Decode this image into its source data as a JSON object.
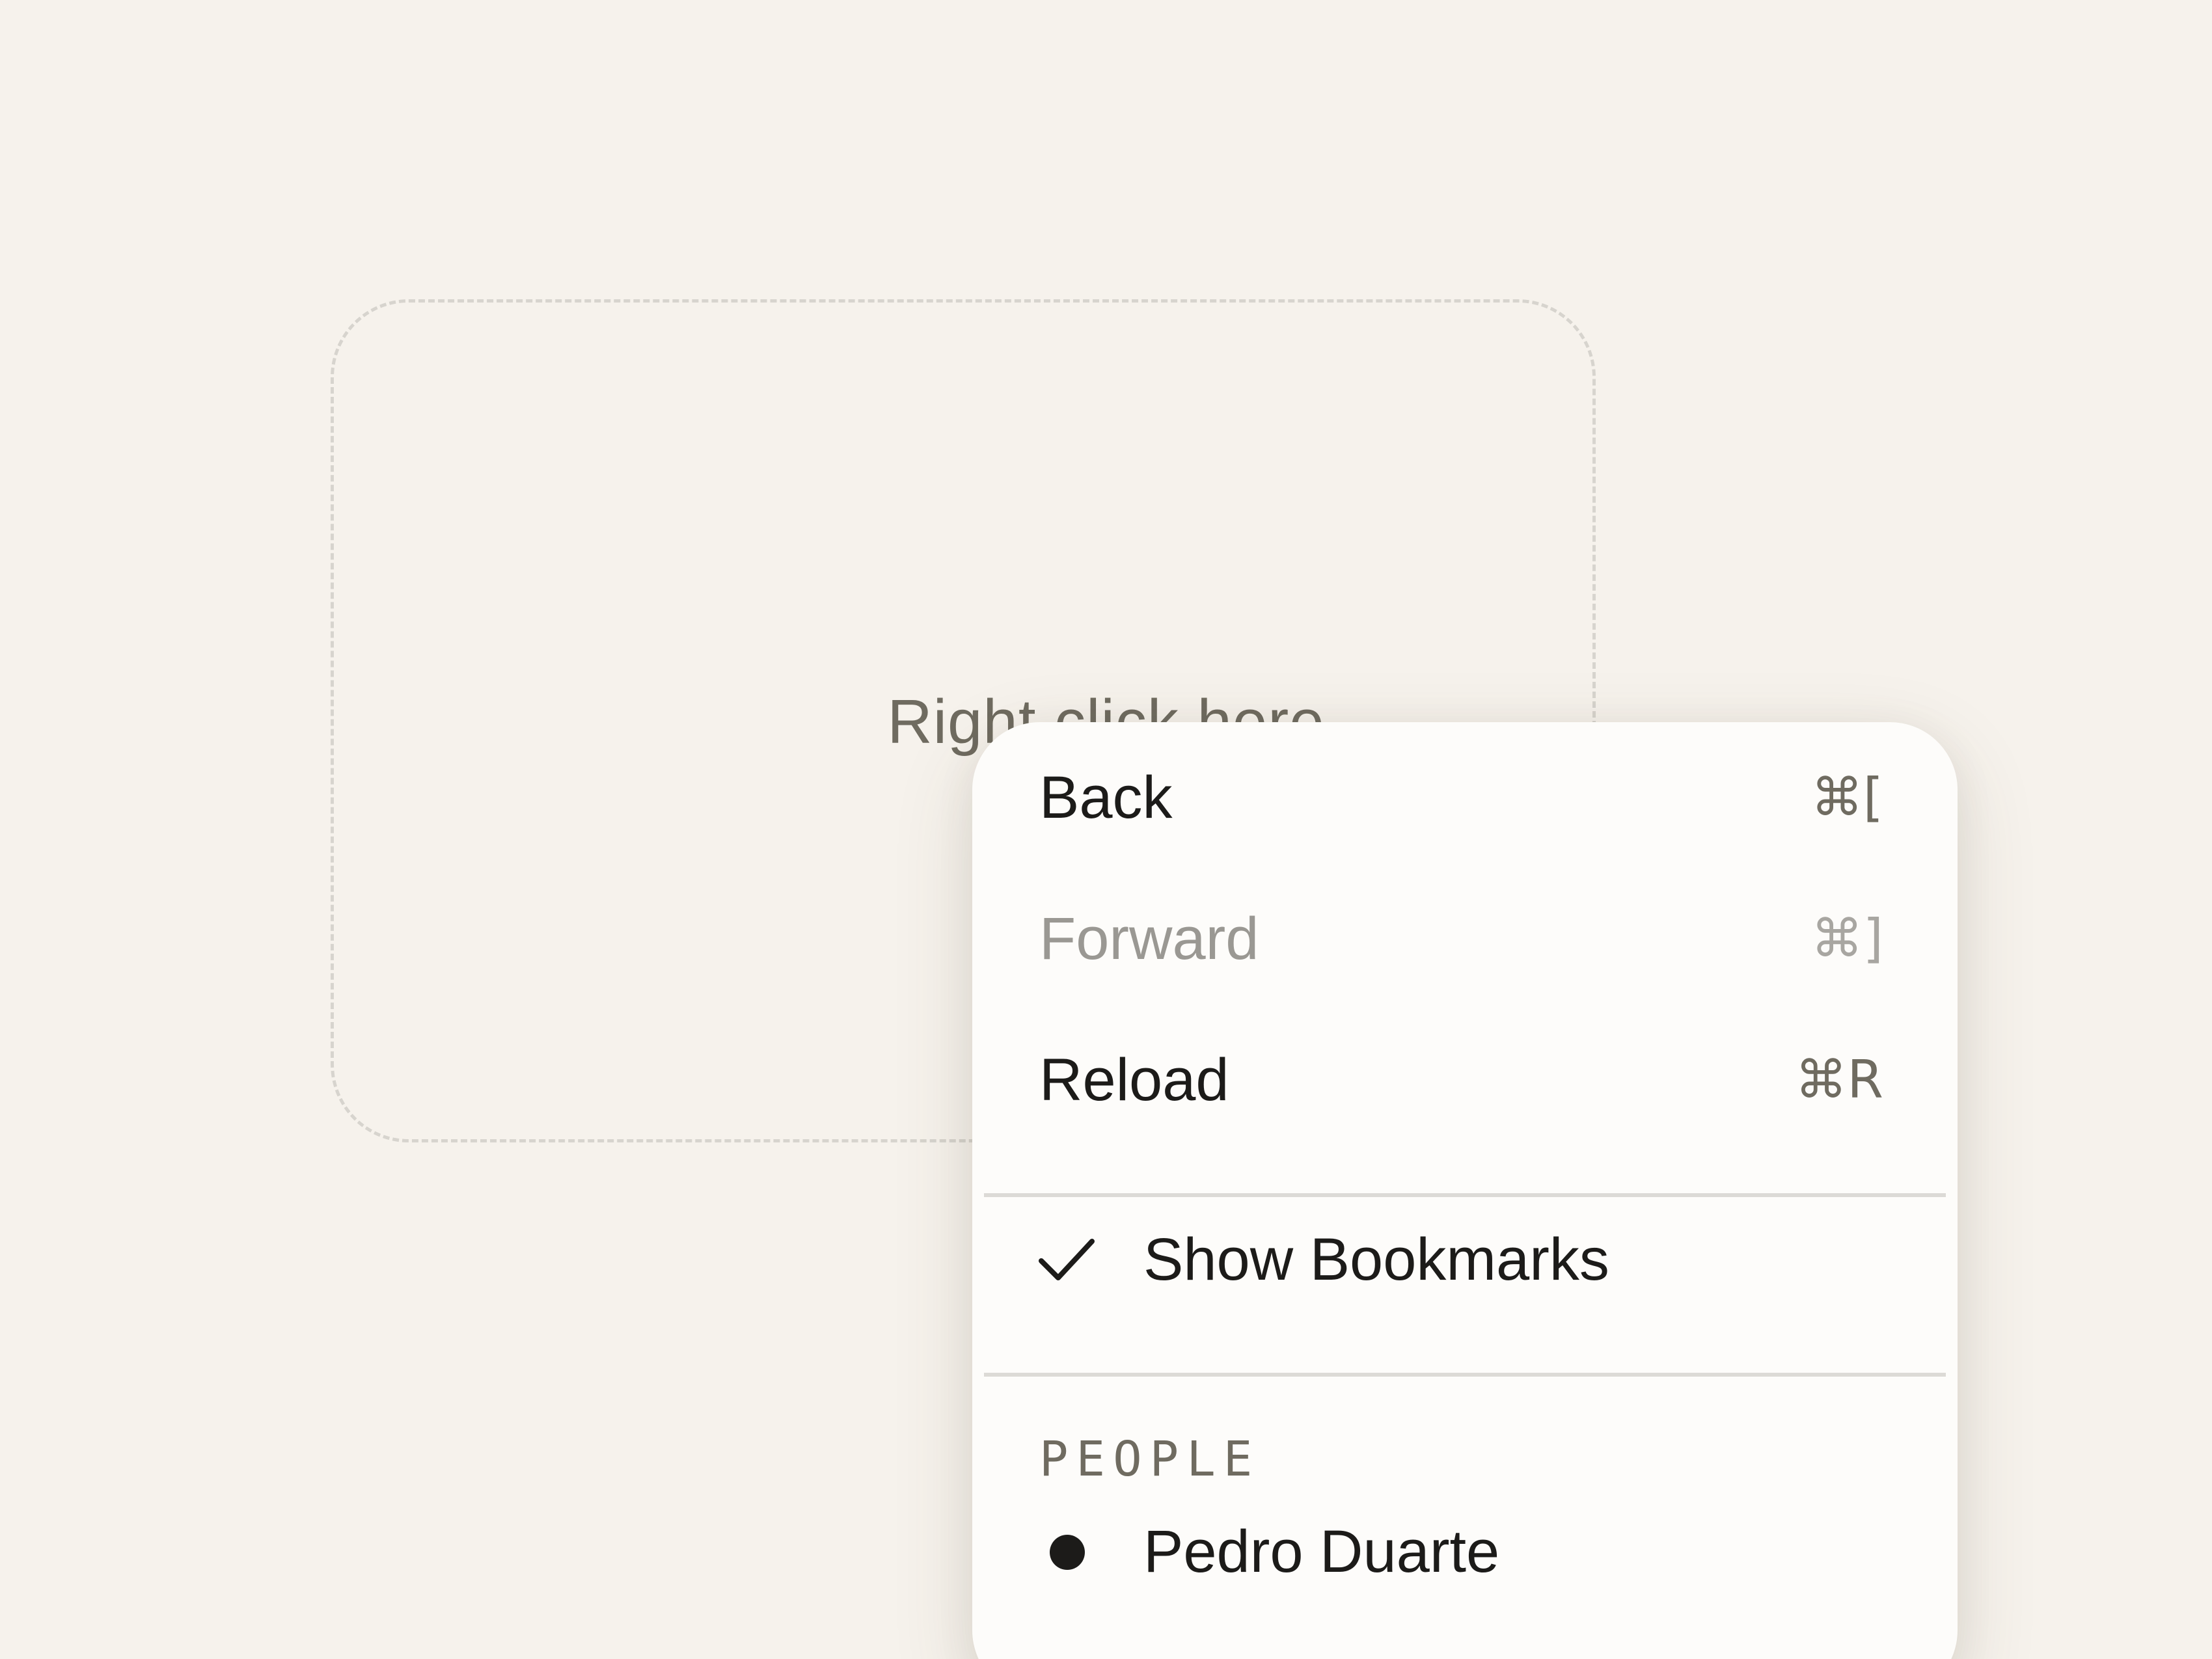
{
  "drop_zone": {
    "label": "Right click here"
  },
  "context_menu": {
    "items": [
      {
        "label": "Back",
        "shortcut": "⌘[",
        "disabled": false
      },
      {
        "label": "Forward",
        "shortcut": "⌘]",
        "disabled": true
      },
      {
        "label": "Reload",
        "shortcut": "⌘R",
        "disabled": false
      }
    ],
    "checkbox_item": {
      "label": "Show Bookmarks",
      "checked": true,
      "icon": "check-icon"
    },
    "group": {
      "label": "PEOPLE",
      "radio_items": [
        {
          "label": "Pedro Duarte",
          "selected": true,
          "icon": "dot-icon"
        }
      ]
    }
  },
  "colors": {
    "background": "#f6f2ec",
    "menu_background": "#fdfcfa",
    "text": "#1c1b19",
    "muted_text": "#6f6b60",
    "disabled_text": "#9a9893",
    "separator": "#dcdad6",
    "dashed_border": "#d7d4ce"
  }
}
